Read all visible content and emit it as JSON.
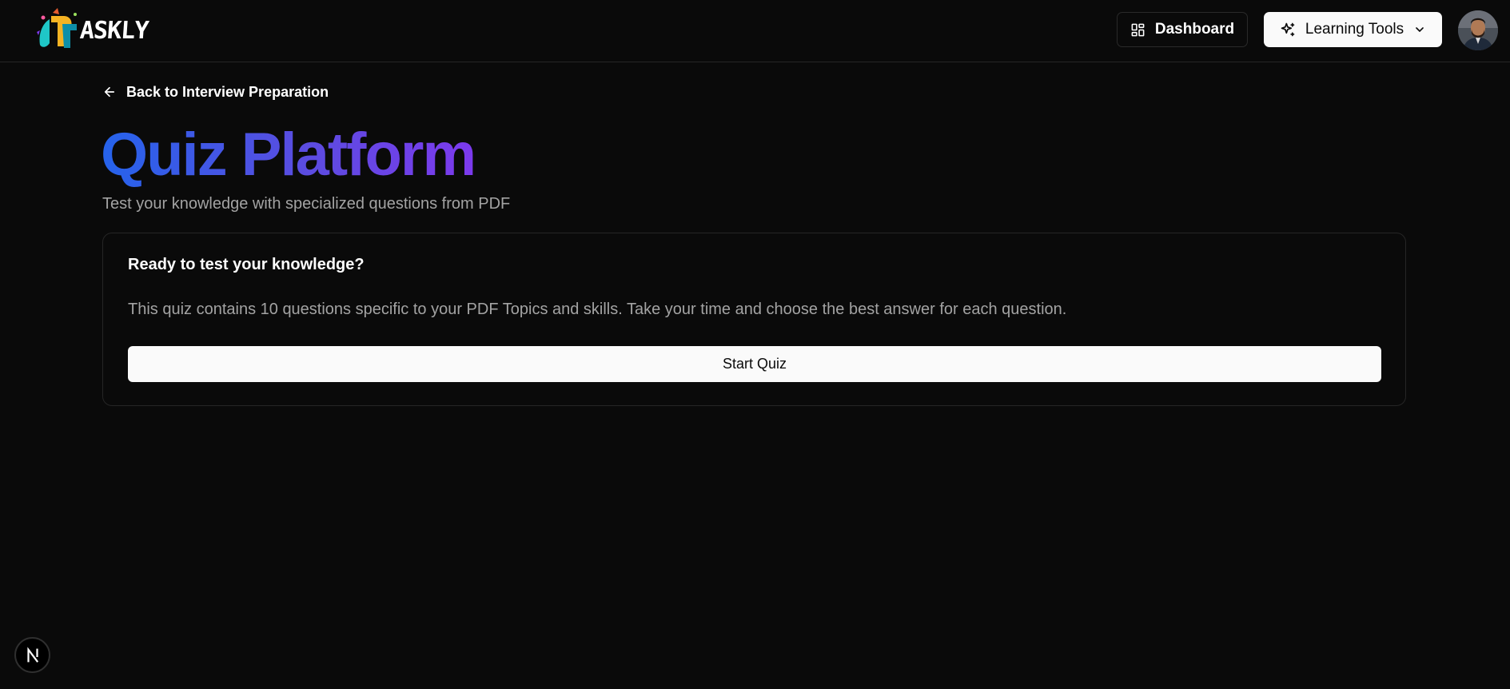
{
  "header": {
    "logo_text": "ASKLY",
    "dashboard_label": "Dashboard",
    "learning_tools_label": "Learning Tools"
  },
  "main": {
    "back_label": "Back to Interview Preparation",
    "title": "Quiz Platform",
    "subtitle": "Test your knowledge with specialized questions from PDF"
  },
  "card": {
    "title": "Ready to test your knowledge?",
    "description": "This quiz contains 10 questions specific to your PDF Topics and skills. Take your time and choose the best answer for each question.",
    "start_label": "Start Quiz"
  },
  "dev": {
    "badge_letter": "N"
  },
  "colors": {
    "background": "#0a0a0a",
    "title_gradient_start": "#2563eb",
    "title_gradient_end": "#7c3aed",
    "muted_text": "#a3a3a3",
    "button_light": "#fafafa"
  },
  "icons": {
    "logo": "askly-logo-icon",
    "dashboard": "layout-grid-icon",
    "learning_tools": "sparkles-icon",
    "dropdown": "chevron-down-icon",
    "back": "arrow-left-icon",
    "avatar": "user-avatar"
  }
}
